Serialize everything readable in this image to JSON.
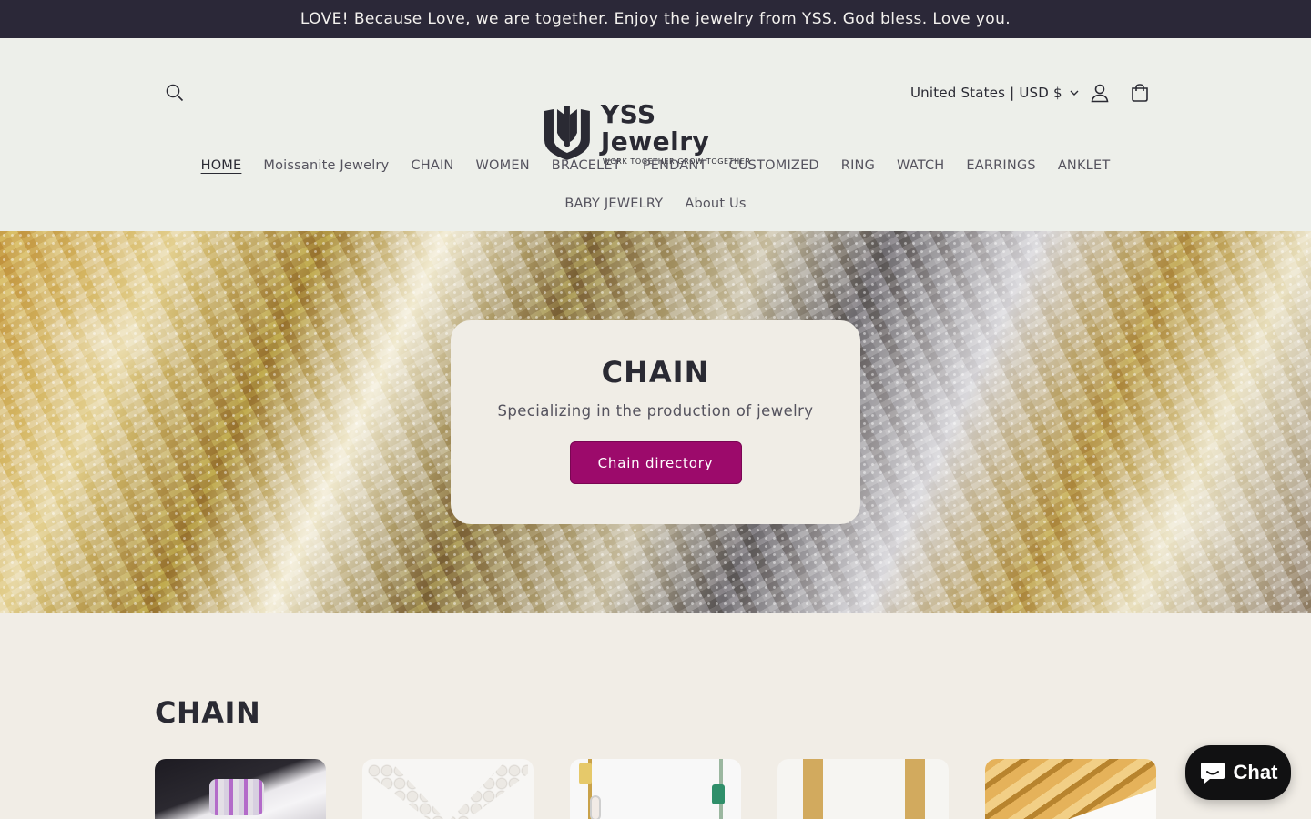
{
  "announcement": "LOVE! Because Love, we are together. Enjoy the jewelry from YSS. God bless. Love you.",
  "logo": {
    "name": "YSS Jewelry",
    "tagline": "WORK TOGETHER GROW TOGETHER"
  },
  "header": {
    "country_selector": "United States | USD $"
  },
  "nav": {
    "row1": [
      "HOME",
      "Moissanite Jewelry",
      "CHAIN",
      "WOMEN",
      "BRACELET",
      "PENDANT",
      "CUSTOMIZED",
      "RING",
      "WATCH",
      "EARRINGS",
      "ANKLET"
    ],
    "row2": [
      "BABY JEWELRY",
      "About Us"
    ],
    "active": "HOME"
  },
  "hero": {
    "title": "CHAIN",
    "subtitle": "Specializing in the production of jewelry",
    "button_label": "Chain directory"
  },
  "section": {
    "title": "CHAIN"
  },
  "chat": {
    "label": "Chat"
  },
  "colors": {
    "announcement_bg": "#2b2838",
    "header_bg": "#edefea",
    "button_accent": "#9c0a6b",
    "page_bg": "#f1ede6"
  },
  "icons": [
    "search-icon",
    "account-icon",
    "cart-icon",
    "chevron-down-icon",
    "chat-icon"
  ]
}
